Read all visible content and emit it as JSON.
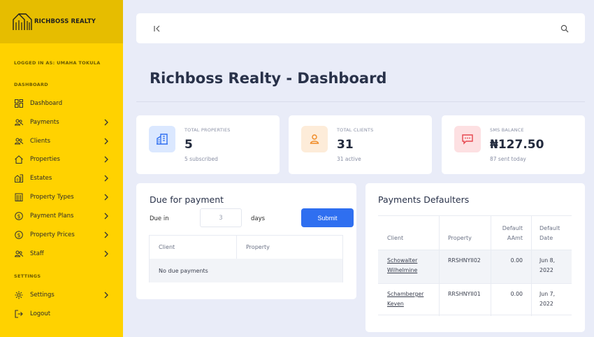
{
  "sidebar": {
    "brand_name": "RICHBOSS REALTY",
    "logged_in": "LOGGED IN AS: UMAHA TOKULA",
    "section_dashboard": "DASHBOARD",
    "section_settings": "SETTINGS",
    "items": [
      {
        "label": "Dashboard",
        "icon": "dashboard-icon",
        "has_chevron": false
      },
      {
        "label": "Payments",
        "icon": "users-icon",
        "has_chevron": true
      },
      {
        "label": "Clients",
        "icon": "users-icon",
        "has_chevron": true
      },
      {
        "label": "Properties",
        "icon": "home-icon",
        "has_chevron": true
      },
      {
        "label": "Estates",
        "icon": "buildings-icon",
        "has_chevron": true
      },
      {
        "label": "Property Types",
        "icon": "building-icon",
        "has_chevron": true
      },
      {
        "label": "Payment Plans",
        "icon": "dollar-icon",
        "has_chevron": true
      },
      {
        "label": "Property Prices",
        "icon": "dollar-icon",
        "has_chevron": true
      },
      {
        "label": "Staff",
        "icon": "users-icon",
        "has_chevron": true
      }
    ],
    "settings_items": [
      {
        "label": "Settings",
        "icon": "gear-icon",
        "has_chevron": true
      },
      {
        "label": "Logout",
        "icon": "logout-icon",
        "has_chevron": false
      }
    ]
  },
  "page": {
    "title": "Richboss Realty - Dashboard"
  },
  "stats": [
    {
      "label": "TOTAL PROPERTIES",
      "value": "5",
      "sub": "5 subscribed",
      "icon": "building-icon",
      "color": "#2f6ff0",
      "bg": "#dbe8ff"
    },
    {
      "label": "TOTAL CLIENTS",
      "value": "31",
      "sub": "31 active",
      "icon": "user-icon",
      "color": "#f08a24",
      "bg": "#fdecd9"
    },
    {
      "label": "SMS BALANCE",
      "value": "₦127.50",
      "sub": "87 sent today",
      "icon": "message-icon",
      "color": "#e6474f",
      "bg": "#fde0e2"
    }
  ],
  "due": {
    "title": "Due for payment",
    "due_in_label": "Due in",
    "days_value": "3",
    "days_label": "days",
    "submit_label": "Submit",
    "columns": [
      "Client",
      "Property"
    ],
    "empty_text": "No due payments"
  },
  "defaulters": {
    "title": "Payments Defaulters",
    "columns": [
      "Client",
      "Property",
      "Default AAmt",
      "Default Date"
    ],
    "rows": [
      {
        "client": "Schowalter Wilhelmine",
        "property": "RRSHNYII02",
        "amount": "0.00",
        "date": "Jun 8, 2022"
      },
      {
        "client": "Schamberger Keven",
        "property": "RRSHNYII01",
        "amount": "0.00",
        "date": "Jun 7, 2022"
      }
    ]
  },
  "colors": {
    "sidebar": "#ffd200",
    "brand_bar": "#e6bd00",
    "primary": "#2f6ff0",
    "background": "#e9ecf8"
  }
}
